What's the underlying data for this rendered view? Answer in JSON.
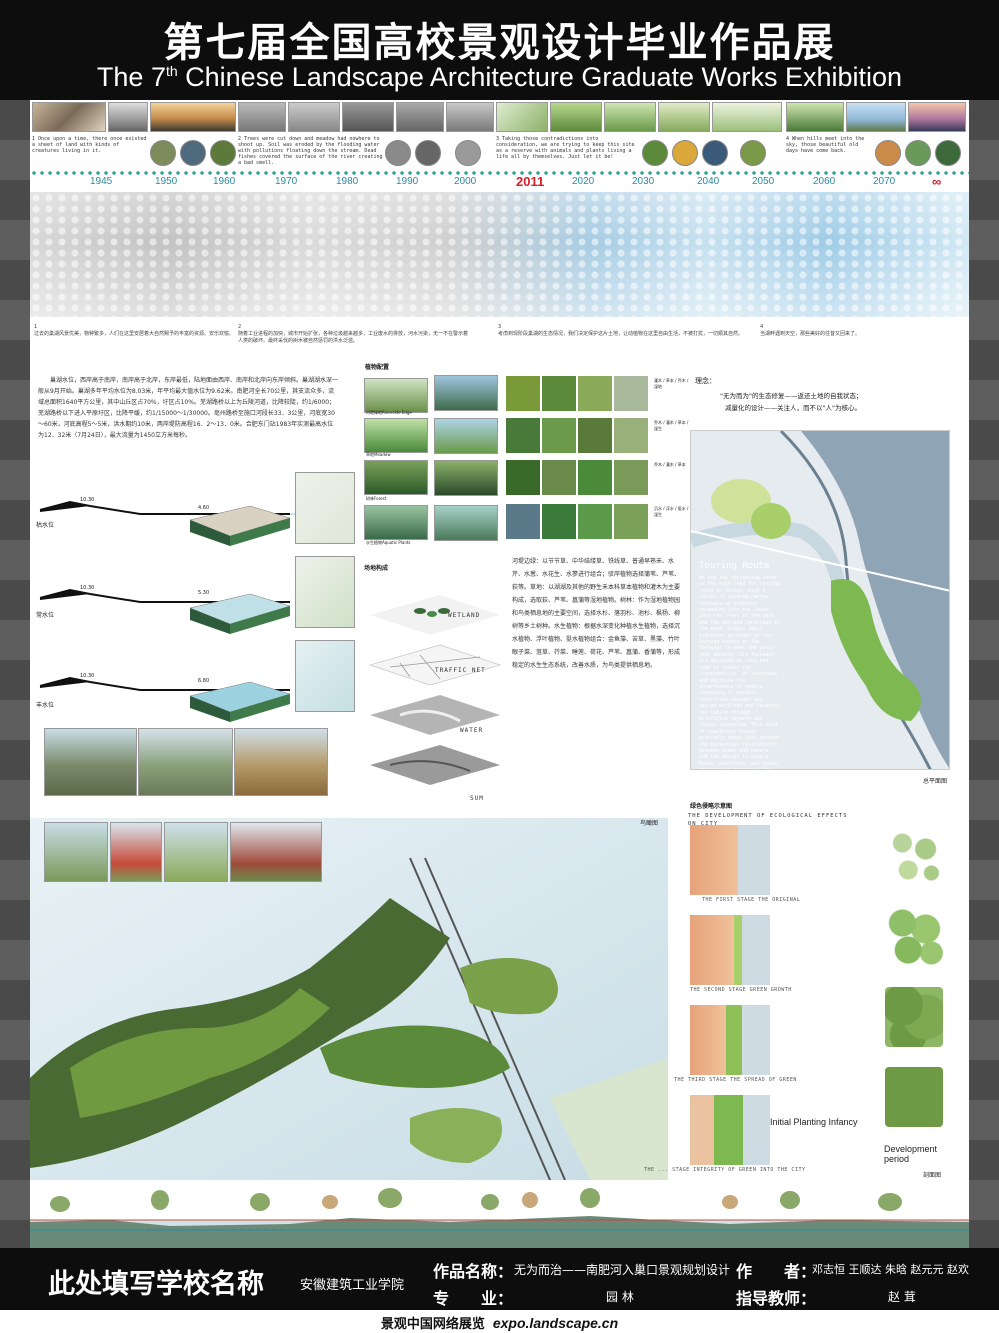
{
  "header": {
    "title_cn": "第七届全国高校景观设计毕业作品展",
    "title_en_prefix": "The 7",
    "title_en_sup": "th",
    "title_en_suffix": " Chinese Landscape Architecture Graduate Works Exhibition"
  },
  "timeline": {
    "eras": [
      {
        "num": "1",
        "text": "Once upon a time, there once existed a sheet of land with kinds of creatures living in it."
      },
      {
        "num": "2",
        "text": "Trees were cut down and meadow had nowhere to shoot up. Soil was eroded by the flooding water with pollutions floating down the stream. Dead fishes covered the surface of the river creating a bad smell."
      },
      {
        "num": "3",
        "text": "Taking those contradictions into consideration, we are trying to keep this site as a reserve with animals and plants living a life all by themselves. Just let it be!"
      },
      {
        "num": "4",
        "text": "When hills meet into the sky, those beautiful old days have come back."
      }
    ],
    "years": [
      "1945",
      "1950",
      "1960",
      "1970",
      "1980",
      "1990",
      "2000",
      "2011",
      "2020",
      "2030",
      "2040",
      "2050",
      "2060",
      "2070",
      "∞"
    ],
    "eras_cn": [
      {
        "num": "1",
        "text": "过去的巢湖风景优美，物种繁多，人们在这里安居着大自然赐予的丰富的资源。安乐欢愉。"
      },
      {
        "num": "2",
        "text": "随着工业进程的加快，城市开始扩张，各种垃圾越来越多，工业废水的排放，河水污染，无一不在警示着人类的破坏。最终采伐的树木被自然惩罚的洪水泛滥。"
      },
      {
        "num": "3",
        "text": "考虑到现阶段巢湖的生态情况，我们决定保护这片土地，让动植物在这里自由生活，不被打扰，一切顺其自然。"
      },
      {
        "num": "4",
        "text": "当湖畔遇到天空，那些美好的往昔又回来了。"
      }
    ]
  },
  "intro": {
    "text": "巢湖水位，西岸高于南岸，南岸高于北岸，东岸最低，陆地面由西岸、南岸和北岸向东岸倾斜。巢湖湖水深一般从9月开始。巢湖多年平均水位为8.03米，年平均最大值水位为9.62米。南肥河全长70公里，其支流众多，流域总面积1640平方公里，其中山丘区占70%，圩区占10%。芜湖路桥以上为丘陵河道，比降较陡，约1/6000；芜湖路桥以下进入平原圩区，比降平缓，约1/15000～1/30000。亳州路桥至施口河段长33．3公里，河底宽30～60米，河底高程5～5米，洪水期约10米，两岸堤防高程16．2～13．0米。合肥东门站1983年实测最高水位为12．32米（7月24日），最大流量为1450立方米每秒。"
  },
  "water_levels": [
    {
      "label": "枯水位",
      "left_mark": "10.30",
      "right_mark": "4.60"
    },
    {
      "label": "常水位",
      "left_mark": "10.30",
      "right_mark": "5.30"
    },
    {
      "label": "丰水位",
      "left_mark": "10.30",
      "right_mark": "6.80"
    }
  ],
  "planting": {
    "title": "植物配置",
    "rows": [
      "河堤绿地Riverside Edge",
      "草地Meadow",
      "树林Forest",
      "水生植物Aquatic Plants"
    ],
    "species_groups": [
      "灌木 / 草本 / 乔木 / 湿地",
      "乔木 / 灌木 / 草本 / 湿生",
      "乔木 / 灌木 / 草本",
      "沉水 / 浮水 / 挺水 / 湿生"
    ]
  },
  "concept": {
    "title": "理念：",
    "line1": "\"无为而为\"的生态修复——返还土地的自我状态；",
    "line2": "减量化的设计——关注人，而不以\"人\"为核心。"
  },
  "structure": {
    "title": "场地构成",
    "layers": [
      "WETLAND",
      "TRAFFIC NET",
      "WATER",
      "SUM"
    ]
  },
  "plant_text": {
    "text": "河堤边绿：以节节草、中华结缕草、铁线草、普通早熟禾、水芹、水葱、水花生、水蓼进行组合；驳岸植物选择蒲苇、芦苇、荻等。草地：以湖湖及其他的野生禾本科草本植物和灌木为主要构成，选取荻、芦苇、菖蒲等湿地植物。树林：作为湿地植物园和鸟类栖息地的主要空间，选择水杉、落羽杉、池杉、枫杨、柳树等乡土树种。水生植物：根据水深变化种植水生植物，选择沉水植物、浮叶植物、挺水植物组合：金鱼藻、苦草、黑藻、竹叶眼子菜、菹草、荇菜、睡莲、荷花、芦苇、菖蒲、香蒲等，形成稳定的水生生态系统，改善水质，为鸟类提供栖息地。"
  },
  "masterplan": {
    "route_title": "Touring Route",
    "route_text": "We use the retreating levee as the main road for touring route in design, with a series of winding narrow footways as branches spreading into the levee, into the trees in the west and the wetland landscape in the east. Simple small platforms arranged at the turning points of the footways to meet the basic rest demands. All footways are designed as step end type to reduce the 'reachability' of landscape and decrease the interference in nature. Lessening of service facilities lessens out design workload and respects the nature through artificial objects and things lessening. This kind of inactivity design precisely takes into account the harmonious relationship between human and nature, and the design is simple. Roads, pavilions, and human are playing a part of the landscape as gentle atmosphere instead of the environment with high strength. Human is only a part of it, so they should belong to the nature and be harmonious with the landscape.",
    "caption": "总平面图"
  },
  "bird": {
    "caption": "鸟瞰图"
  },
  "development": {
    "title_cn": "绿色侵略示意图",
    "title_en": "The development of ecological effects on city",
    "stages": [
      "The first stage  The original",
      "The second stage  Green growth",
      "The third stage  The spread of green",
      "The ... stage  Integrity of green into the city"
    ],
    "infancy": "Initial Planting Infancy",
    "period_line1": "Development",
    "period_line2": "period",
    "caption": "剖面图"
  },
  "footer": {
    "school_placeholder": "此处填写学校名称",
    "school_name": "安徽建筑工业学院",
    "work_label": "作品名称：",
    "work_value": "无为而治——南肥河入巢口景观规划设计",
    "author_label": "作　　者：",
    "author_value": "邓志恒 王顺达 朱晗 赵元元 赵欢",
    "major_label": "专　　业：",
    "major_value": "园 林",
    "advisor_label": "指导教师：",
    "advisor_value": "赵 茸"
  },
  "bottom": {
    "cn": "景观中国网络展览",
    "url": "expo.landscape.cn"
  }
}
